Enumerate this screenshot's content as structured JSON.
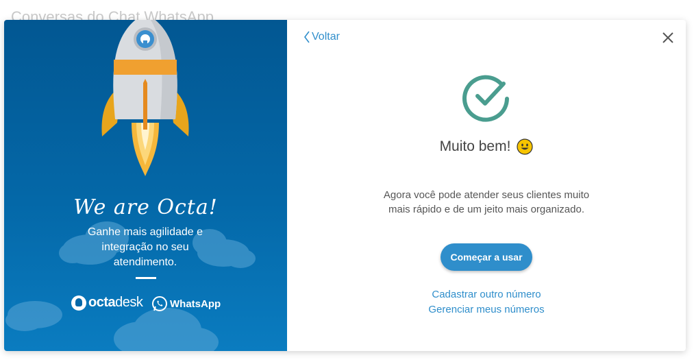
{
  "background": {
    "title": "Conversas do Chat WhatsApp"
  },
  "left_panel": {
    "slogan": "We are Octa!",
    "tagline": "Ganhe mais agilidade e integração no seu atendimento.",
    "brands": {
      "octa_bold": "octa",
      "octa_thin": "desk",
      "whatsapp": "WhatsApp"
    }
  },
  "right_panel": {
    "back_label": "Voltar",
    "heading": "Muito bem!",
    "message": "Agora você pode atender seus clientes muito mais rápido e de um jeito mais organizado.",
    "primary_button": "Começar a usar",
    "links": [
      "Cadastrar outro número",
      "Gerenciar meus números"
    ]
  },
  "colors": {
    "panel_blue": "#025792",
    "accent_blue": "#2f8ecb",
    "check_green": "#4a9d8f",
    "rocket_orange": "#f0a030"
  },
  "icons": [
    "rocket-illustration",
    "cloud-icon",
    "chevron-left-icon",
    "close-icon",
    "check-circle-icon",
    "smiley-emoji-icon",
    "octadesk-logo-icon",
    "whatsapp-icon"
  ]
}
